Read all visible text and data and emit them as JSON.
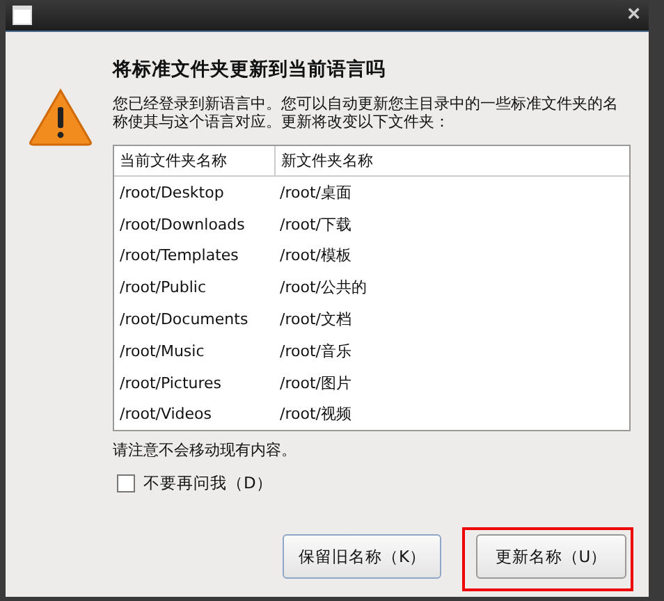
{
  "window": {
    "close": "×"
  },
  "dialog": {
    "title": "将标准文件夹更新到当前语言吗",
    "message": "您已经登录到新语言中。您可以自动更新您主目录中的一些标准文件夹的名称使其与这个语言对应。更新将改变以下文件夹：",
    "table": {
      "columns": [
        "当前文件夹名称",
        "新文件夹名称"
      ],
      "rows": [
        [
          "/root/Desktop",
          "/root/桌面"
        ],
        [
          "/root/Downloads",
          "/root/下载"
        ],
        [
          "/root/Templates",
          "/root/模板"
        ],
        [
          "/root/Public",
          "/root/公共的"
        ],
        [
          "/root/Documents",
          "/root/文档"
        ],
        [
          "/root/Music",
          "/root/音乐"
        ],
        [
          "/root/Pictures",
          "/root/图片"
        ],
        [
          "/root/Videos",
          "/root/视频"
        ]
      ]
    },
    "note": "请注意不会移动现有内容。",
    "checkbox": {
      "label": "不要再问我（D）",
      "checked": false
    },
    "buttons": [
      {
        "label": "保留旧名称（K）",
        "highlighted": false
      },
      {
        "label": "更新名称（U）",
        "highlighted": true
      }
    ]
  }
}
